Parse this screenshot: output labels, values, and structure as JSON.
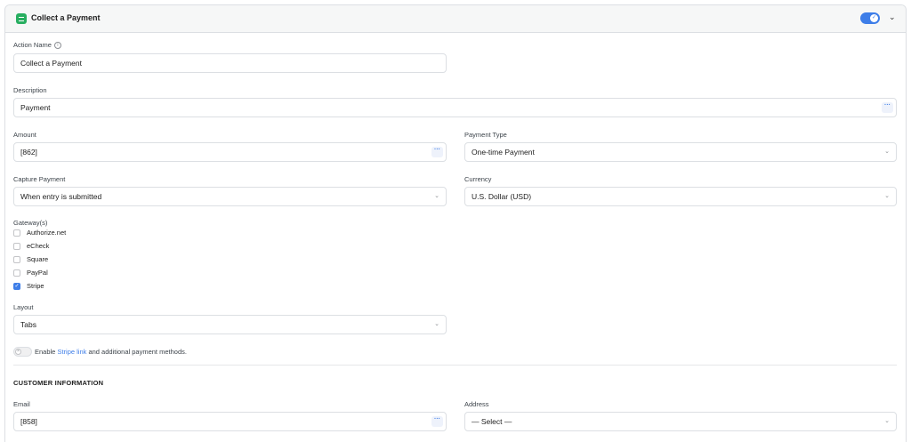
{
  "header": {
    "title": "Collect a Payment",
    "icon": "feed-icon",
    "toggle_on": true
  },
  "action_name": {
    "label": "Action Name",
    "value": "Collect a Payment"
  },
  "description": {
    "label": "Description",
    "value": "Payment"
  },
  "amount": {
    "label": "Amount",
    "value": "[862]"
  },
  "payment_type": {
    "label": "Payment Type",
    "value": "One-time Payment"
  },
  "capture_payment": {
    "label": "Capture Payment",
    "value": "When entry is submitted"
  },
  "currency": {
    "label": "Currency",
    "value": "U.S. Dollar (USD)"
  },
  "gateways": {
    "label": "Gateway(s)",
    "items": [
      {
        "label": "Authorize.net",
        "checked": false
      },
      {
        "label": "eCheck",
        "checked": false
      },
      {
        "label": "Square",
        "checked": false
      },
      {
        "label": "PayPal",
        "checked": false
      },
      {
        "label": "Stripe",
        "checked": true
      }
    ]
  },
  "layout": {
    "label": "Layout",
    "value": "Tabs"
  },
  "stripe_link": {
    "prefix": "Enable ",
    "link": "Stripe link",
    "suffix": " and additional payment methods.",
    "enabled": false
  },
  "customer_info": {
    "title": "CUSTOMER INFORMATION",
    "email": {
      "label": "Email",
      "value": "[858]"
    },
    "address": {
      "label": "Address",
      "value": "— Select —"
    }
  },
  "colors": {
    "accent": "#3e7ee8",
    "icon_green": "#27ae60"
  }
}
